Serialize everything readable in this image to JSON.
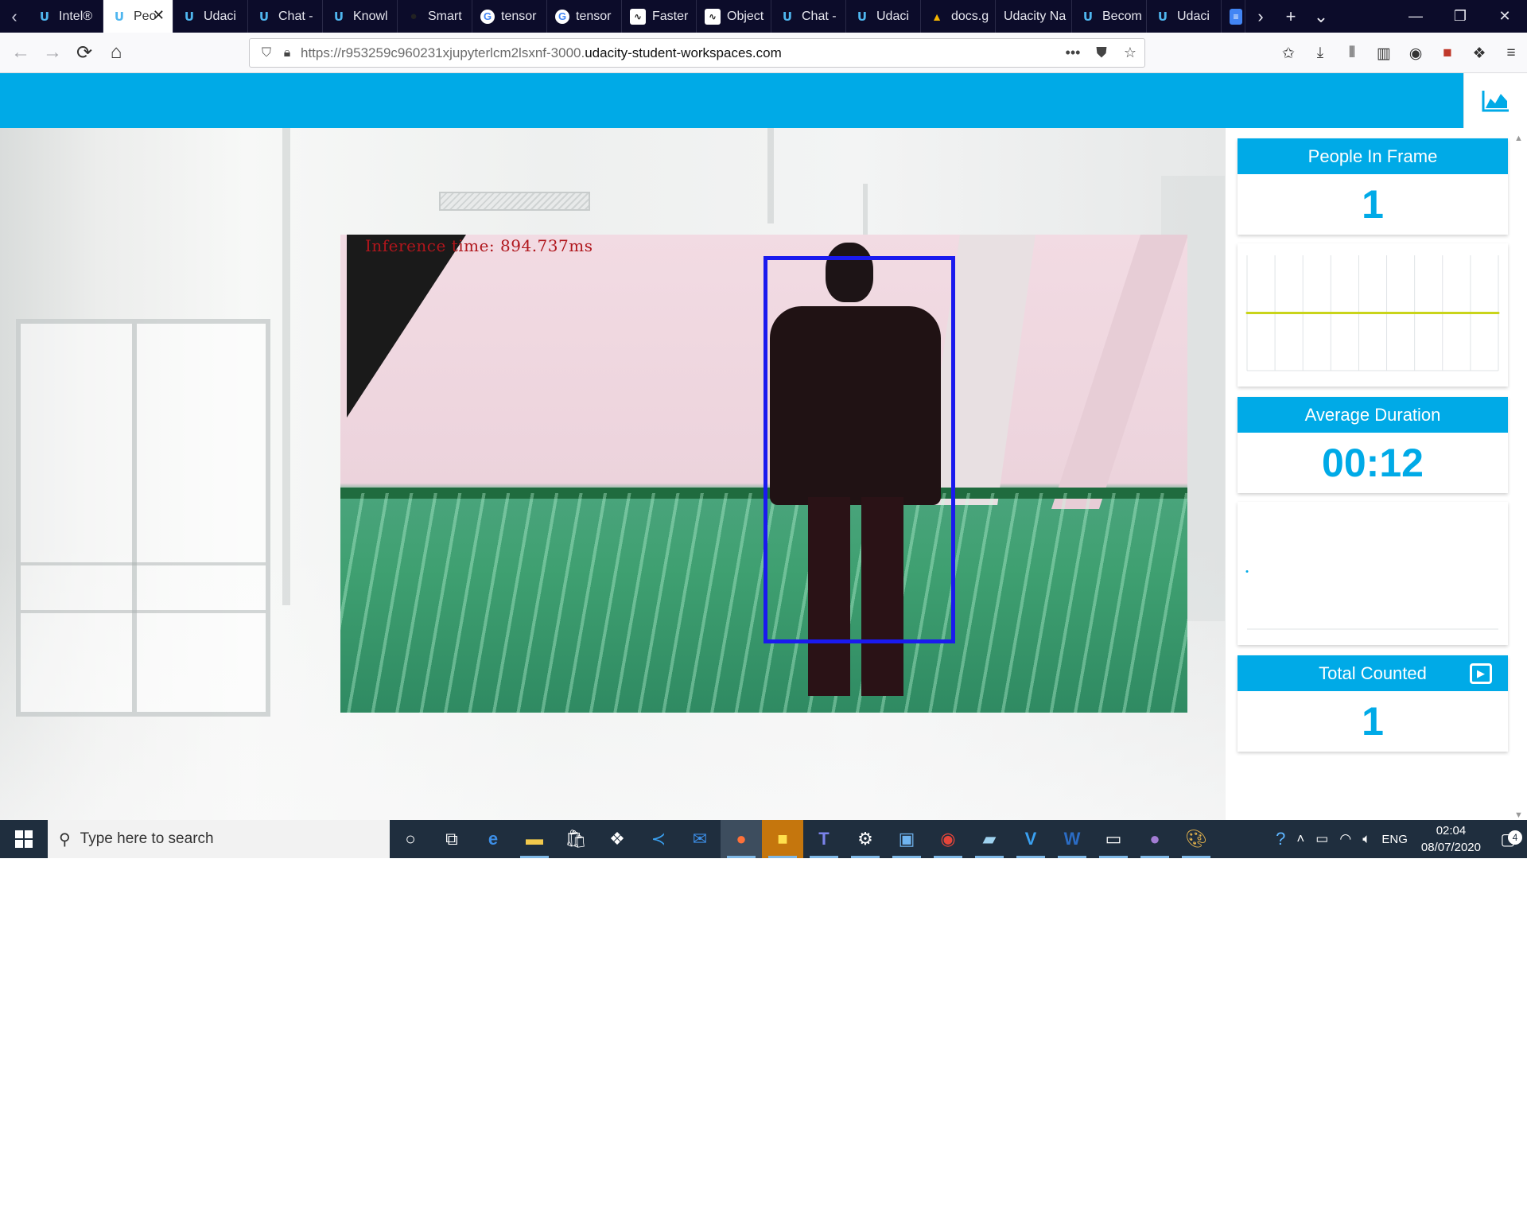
{
  "browser": {
    "tabs": [
      {
        "label": "Intel®",
        "icon": "udacity-icon"
      },
      {
        "label": "Peo",
        "icon": "udacity-icon",
        "active": true
      },
      {
        "label": "Udaci",
        "icon": "udacity-icon"
      },
      {
        "label": "Chat -",
        "icon": "udacity-icon"
      },
      {
        "label": "Knowl",
        "icon": "udacity-icon"
      },
      {
        "label": "Smart",
        "icon": "github-icon"
      },
      {
        "label": "tensor",
        "icon": "google-icon"
      },
      {
        "label": "tensor",
        "icon": "google-icon"
      },
      {
        "label": "Faster",
        "icon": "chart-icon"
      },
      {
        "label": "Object",
        "icon": "chart-icon"
      },
      {
        "label": "Chat -",
        "icon": "udacity-icon"
      },
      {
        "label": "Udaci",
        "icon": "udacity-icon"
      },
      {
        "label": "docs.g",
        "icon": "drive-icon"
      },
      {
        "label": "Udacity Na",
        "icon": ""
      },
      {
        "label": "Becom",
        "icon": "udacity-icon"
      },
      {
        "label": "Udaci",
        "icon": "udacity-icon"
      }
    ],
    "url_prefix": "https://r953259c960231xjupyterlcm2lsxnf-3000.",
    "url_domain": "udacity-student-workspaces.com"
  },
  "app": {
    "video": {
      "inference_text": "Inference time: 894.737ms"
    },
    "stats": {
      "people_in_frame": {
        "title": "People In Frame",
        "value": "1"
      },
      "average_duration": {
        "title": "Average Duration",
        "value": "00:12"
      },
      "total_counted": {
        "title": "Total Counted",
        "value": "1"
      }
    },
    "colors": {
      "accent": "#00aae7",
      "chart_line": "#c9d41a",
      "bbox": "#1a1aee"
    }
  },
  "chart_data": [
    {
      "type": "line",
      "series": [
        {
          "values": [
            1,
            1,
            1,
            1,
            1,
            1,
            1,
            1,
            1,
            1
          ]
        }
      ],
      "x": [
        1,
        2,
        3,
        4,
        5,
        6,
        7,
        8,
        9,
        10
      ],
      "grid": true
    },
    {
      "type": "line",
      "series": [
        {
          "values": [
            1
          ]
        }
      ],
      "x": [
        1
      ],
      "grid": false
    }
  ],
  "taskbar": {
    "search_placeholder": "Type here to search",
    "language": "ENG",
    "time": "02:04",
    "date": "08/07/2020",
    "notification_count": "4"
  }
}
